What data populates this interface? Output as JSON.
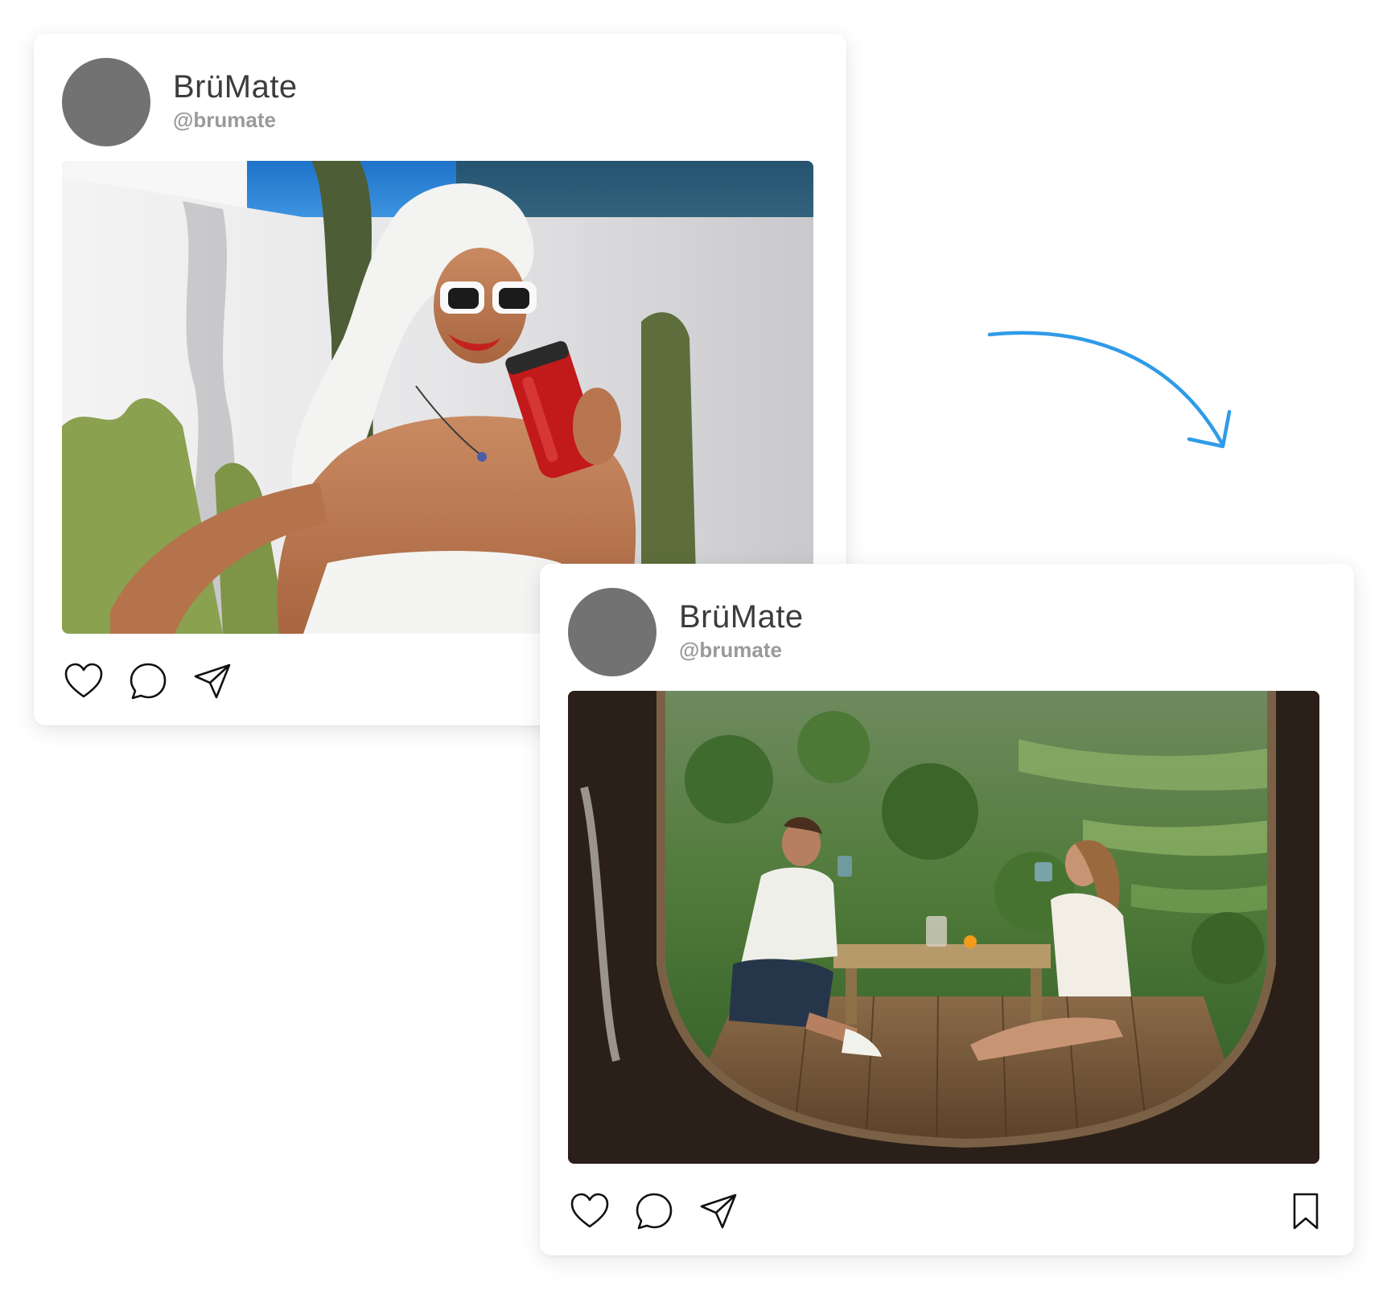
{
  "posts": [
    {
      "account": {
        "name": "BrüMate",
        "handle": "@brumate"
      },
      "image": {
        "description_icon": "photo-woman-towel-red-tumbler"
      },
      "actions": {
        "like": "heart-icon",
        "comment": "comment-icon",
        "share": "send-icon"
      }
    },
    {
      "account": {
        "name": "BrüMate",
        "handle": "@brumate"
      },
      "image": {
        "description_icon": "photo-couple-jungle-terrace"
      },
      "actions": {
        "like": "heart-icon",
        "comment": "comment-icon",
        "share": "send-icon",
        "save": "bookmark-icon"
      }
    }
  ],
  "theme": {
    "arrow_color": "#2f9be8",
    "avatar_color": "#727272",
    "name_color": "#3c3c3c",
    "handle_color": "#9a9a9a"
  }
}
